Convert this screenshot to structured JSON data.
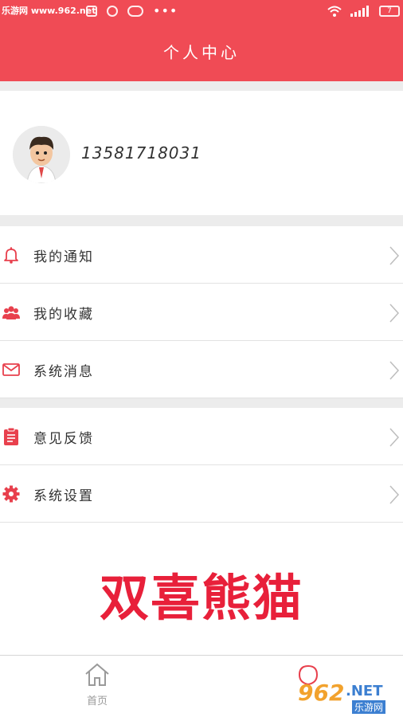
{
  "status_bar": {
    "watermark": "乐游网 www.962.net",
    "dots": "•••",
    "battery_text": "7"
  },
  "header": {
    "title": "个人中心"
  },
  "profile": {
    "phone": "13581718031"
  },
  "menu": [
    {
      "label": "我的通知",
      "icon": "bell-icon"
    },
    {
      "label": "我的收藏",
      "icon": "users-icon"
    },
    {
      "label": "系统消息",
      "icon": "envelope-icon"
    },
    {
      "label": "意见反馈",
      "icon": "clipboard-icon"
    },
    {
      "label": "系统设置",
      "icon": "gear-icon"
    }
  ],
  "promo_text": "双喜熊猫",
  "tab_bar": {
    "home_label": "首页"
  },
  "watermark": {
    "number": "962",
    "domain": ".NET",
    "name": "乐游网"
  },
  "colors": {
    "header": "#f04b55",
    "promo": "#e8203a",
    "icon": "#e8404d"
  }
}
